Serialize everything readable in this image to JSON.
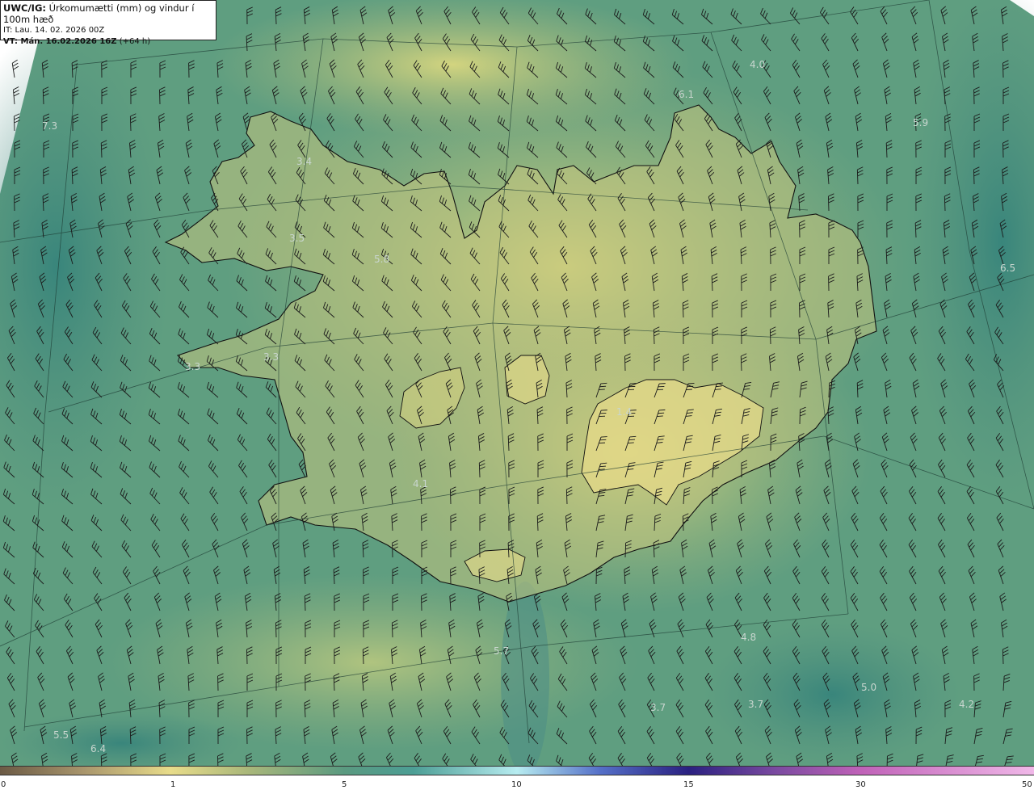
{
  "header": {
    "model": "UWC/IG:",
    "variable": "Úrkomumætti (mm) og vindur í 100m hæð",
    "init_time": "IT: Lau. 14. 02. 2026 00Z",
    "valid_prefix": "VT: Mán. 16.02.2026 16Z",
    "valid_suffix": "(+64 h)"
  },
  "map_labels": [
    {
      "text": "7.3"
    },
    {
      "text": "3.4"
    },
    {
      "text": "3.5"
    },
    {
      "text": "5.8"
    },
    {
      "text": "3.3"
    },
    {
      "text": "3.3"
    },
    {
      "text": "6.1"
    },
    {
      "text": "4.0"
    },
    {
      "text": "5.9"
    },
    {
      "text": "6.5"
    },
    {
      "text": "4.1"
    },
    {
      "text": "5.7"
    },
    {
      "text": "4.8"
    },
    {
      "text": "5.0"
    },
    {
      "text": "4.2"
    },
    {
      "text": "3.7"
    },
    {
      "text": "3.7"
    },
    {
      "text": "5.5"
    },
    {
      "text": "6.4"
    },
    {
      "text": "1.4"
    }
  ],
  "colorbar": {
    "ticks": [
      "0",
      "1",
      "5",
      "10",
      "15",
      "30",
      "50"
    ],
    "colors": [
      "#6b5a45",
      "#e8dc8a",
      "#5a9a80",
      "#b7ecf0",
      "#2a2080",
      "#c062b8",
      "#f0b8e8"
    ]
  }
}
